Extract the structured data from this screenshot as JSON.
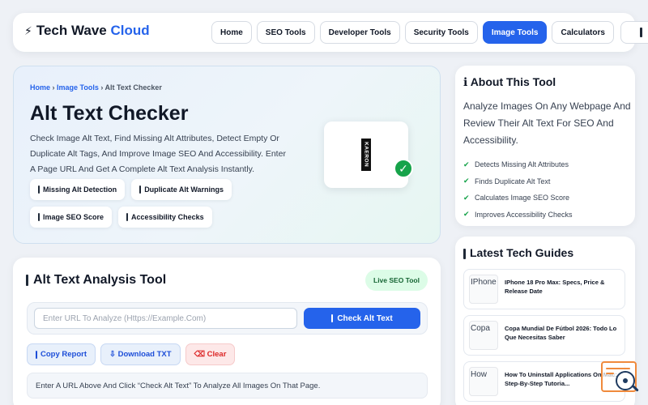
{
  "header": {
    "logo_icon": "⚡",
    "logo_text": "Tech Wave",
    "logo_accent": "Cloud",
    "nav": [
      {
        "label": "Home"
      },
      {
        "label": "SEO Tools"
      },
      {
        "label": "Developer Tools"
      },
      {
        "label": "Security Tools"
      },
      {
        "label": "Image Tools",
        "active": true
      },
      {
        "label": "Calculators"
      }
    ],
    "menu_icon": "menu-icon"
  },
  "hero": {
    "breadcrumb": {
      "home": "Home",
      "sep1": " › ",
      "section": "Image Tools",
      "sep2": " › ",
      "current": "Alt Text Checker"
    },
    "title": "Alt Text Checker",
    "description": "Check Image Alt Text, Find Missing Alt Attributes, Detect Empty Or Duplicate Alt Tags, And Improve Image SEO And Accessibility. Enter A Page URL And Get A Complete Alt Text Analysis Instantly.",
    "chips": [
      "Missing Alt Detection",
      "Duplicate Alt Warnings",
      "Image SEO Score",
      "Accessibility Checks"
    ],
    "card_logo_text": "KAERON",
    "card_badge": "✓"
  },
  "tool": {
    "title": "Alt Text Analysis Tool",
    "badge": "Live SEO Tool",
    "url_placeholder": "Enter URL To Analyze (Https://Example.Com)",
    "url_value": "",
    "check_label": "Check Alt Text",
    "copy_label": "Copy Report",
    "download_label": "⇩ Download TXT",
    "clear_label": "⌫ Clear",
    "hint": "Enter A URL Above And Click “Check Alt Text” To Analyze All Images On That Page."
  },
  "about": {
    "title": "ℹ About This Tool",
    "description": "Analyze Images On Any Webpage And Review Their Alt Text For SEO And Accessibility.",
    "items": [
      "Detects Missing Alt Attributes",
      "Finds Duplicate Alt Text",
      "Calculates Image SEO Score",
      "Improves Accessibility Checks"
    ],
    "tick": "✔"
  },
  "guides": {
    "title": "Latest Tech Guides",
    "items": [
      {
        "thumb_alt": "IPhone",
        "title": "IPhone 18 Pro Max: Specs, Price & Release Date"
      },
      {
        "thumb_alt": "Copa",
        "title": "Copa Mundial De Fútbol 2026: Todo Lo Que Necesitas Saber"
      },
      {
        "thumb_alt": "How",
        "title": "How To Uninstall Applications On Mac: Step-By-Step Tutoria..."
      }
    ]
  },
  "colors": {
    "accent": "#2563eb",
    "success": "#16a34a",
    "danger": "#dc2626",
    "widget": "#f08a3c"
  }
}
